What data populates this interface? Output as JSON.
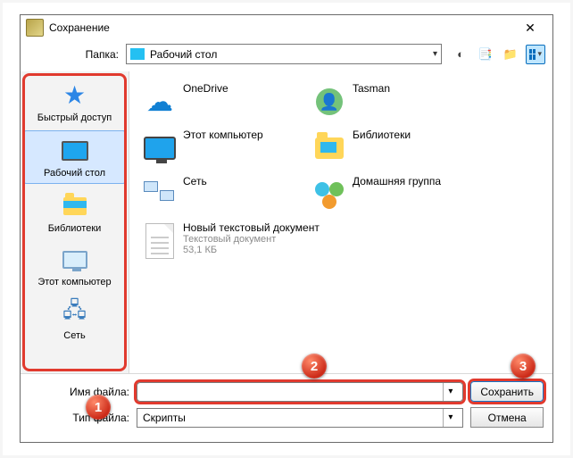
{
  "window": {
    "title": "Сохранение"
  },
  "toolbar": {
    "folder_label": "Папка:",
    "current_folder": "Рабочий стол"
  },
  "places": [
    {
      "label": "Быстрый доступ"
    },
    {
      "label": "Рабочий стол"
    },
    {
      "label": "Библиотеки"
    },
    {
      "label": "Этот компьютер"
    },
    {
      "label": "Сеть"
    }
  ],
  "files": [
    {
      "name": "OneDrive"
    },
    {
      "name": "Tasman"
    },
    {
      "name": "Этот компьютер"
    },
    {
      "name": "Библиотеки"
    },
    {
      "name": "Сеть"
    },
    {
      "name": "Домашняя группа"
    },
    {
      "name": "Новый текстовый документ",
      "type": "Текстовый документ",
      "size": "53,1 КБ"
    }
  ],
  "bottom": {
    "filename_label": "Имя файла:",
    "filename_value": "",
    "filetype_label": "Тип файла:",
    "filetype_value": "Скрипты",
    "save": "Сохранить",
    "cancel": "Отмена"
  },
  "callouts": {
    "one": "1",
    "two": "2",
    "three": "3"
  }
}
